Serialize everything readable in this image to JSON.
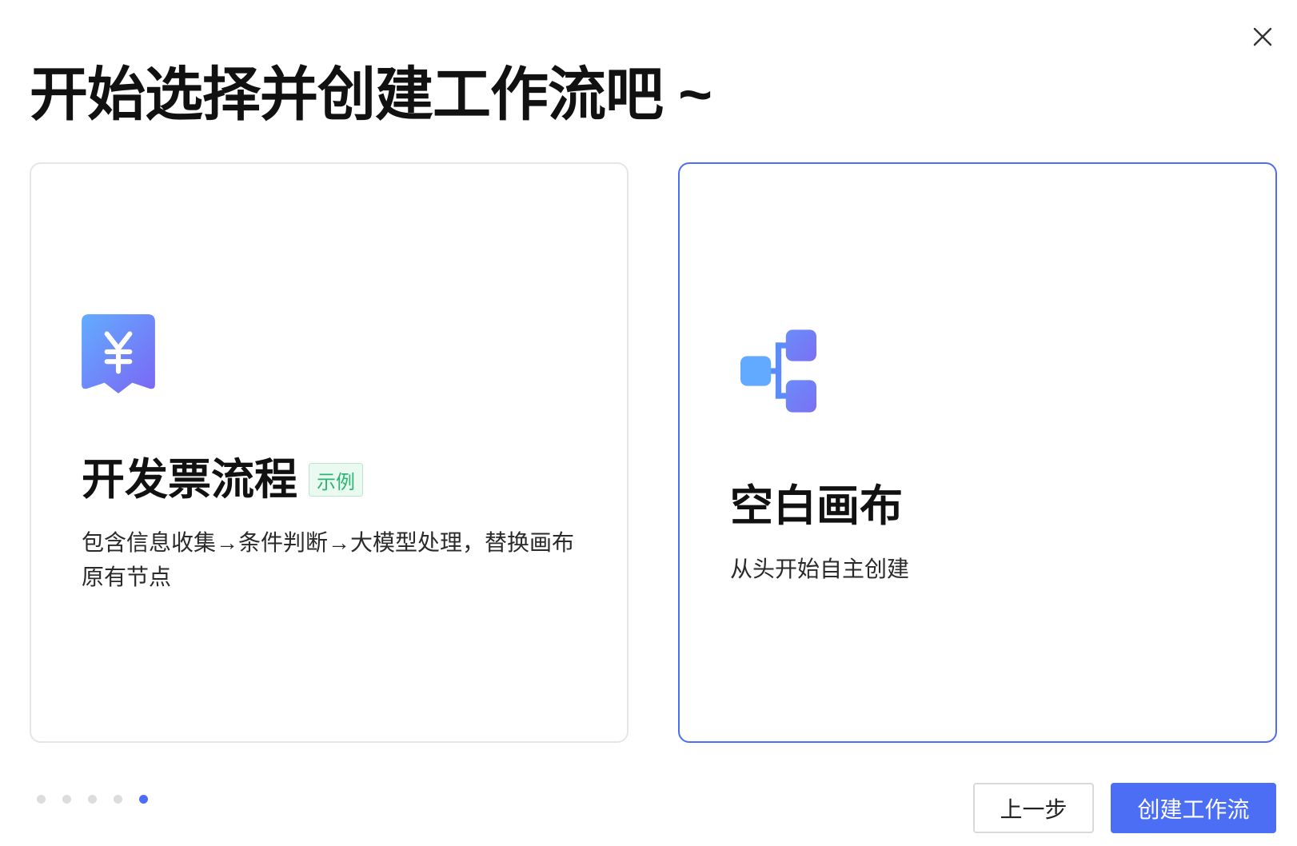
{
  "dialog": {
    "title": "开始选择并创建工作流吧 ~",
    "close_icon": "close-icon"
  },
  "cards": [
    {
      "title": "开发票流程",
      "tag": "示例",
      "description": "包含信息收集→条件判断→大模型处理，替换画布原有节点",
      "icon": "receipt-yuan-icon",
      "selected": false
    },
    {
      "title": "空白画布",
      "description": "从头开始自主创建",
      "icon": "flowchart-icon",
      "selected": true
    }
  ],
  "pagination": {
    "total": 5,
    "current": 5
  },
  "buttons": {
    "prev": "上一步",
    "create": "创建工作流"
  },
  "colors": {
    "accent": "#4c6ef5",
    "tag_text": "#2bb673",
    "tag_background": "#eafaf1",
    "card_border": "#e6e6e6"
  }
}
